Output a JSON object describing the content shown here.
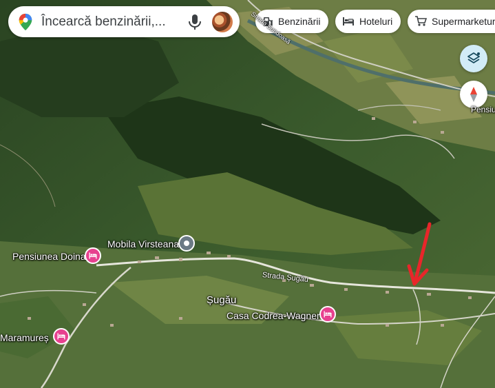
{
  "search": {
    "query": "Încearcă benzinării,..."
  },
  "chips": [
    {
      "label": "Benzinării",
      "icon": "gas-station-icon"
    },
    {
      "label": "Hoteluri",
      "icon": "bed-icon"
    },
    {
      "label": "Supermarketuri",
      "icon": "cart-icon"
    }
  ],
  "places": {
    "pensiunea_doina": "Pensiunea Doina",
    "mobila_virsteana": "Mobila Virsteana",
    "sugau": "Șugău",
    "casa_codrea": "Casa Codrea-Wagner",
    "maramures": "Maramureș",
    "pensiu_edge": "Pensiu"
  },
  "roads": {
    "strada_sugau": "Strada Șugău",
    "top_road": "Strada Sundoasă"
  },
  "colors": {
    "pin": "#e7418f",
    "arrow": "#e8262a",
    "layers": "#d2ecf7"
  }
}
